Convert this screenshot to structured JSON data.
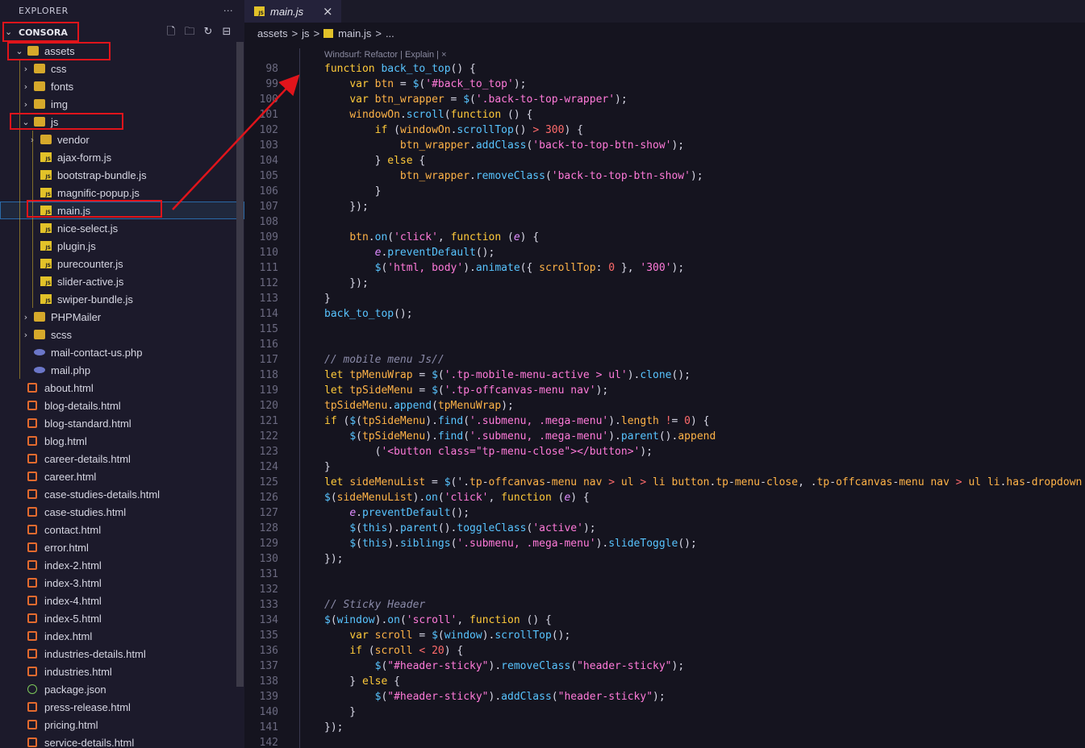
{
  "sidebar": {
    "title": "EXPLORER",
    "more_icon": "ellipsis-icon",
    "project": "CONSORA",
    "items": [
      {
        "label": "assets",
        "type": "folder",
        "state": "open"
      },
      {
        "label": "css",
        "type": "folder",
        "state": "closed"
      },
      {
        "label": "fonts",
        "type": "folder",
        "state": "closed"
      },
      {
        "label": "img",
        "type": "folder",
        "state": "closed"
      },
      {
        "label": "js",
        "type": "folder",
        "state": "open"
      },
      {
        "label": "vendor",
        "type": "folder",
        "state": "closed"
      },
      {
        "label": "ajax-form.js",
        "type": "js"
      },
      {
        "label": "bootstrap-bundle.js",
        "type": "js"
      },
      {
        "label": "magnific-popup.js",
        "type": "js"
      },
      {
        "label": "main.js",
        "type": "js",
        "selected": true
      },
      {
        "label": "nice-select.js",
        "type": "js"
      },
      {
        "label": "plugin.js",
        "type": "js"
      },
      {
        "label": "purecounter.js",
        "type": "js"
      },
      {
        "label": "slider-active.js",
        "type": "js"
      },
      {
        "label": "swiper-bundle.js",
        "type": "js"
      },
      {
        "label": "PHPMailer",
        "type": "folder",
        "state": "closed"
      },
      {
        "label": "scss",
        "type": "folder",
        "state": "closed"
      },
      {
        "label": "mail-contact-us.php",
        "type": "php"
      },
      {
        "label": "mail.php",
        "type": "php"
      },
      {
        "label": "about.html",
        "type": "html"
      },
      {
        "label": "blog-details.html",
        "type": "html"
      },
      {
        "label": "blog-standard.html",
        "type": "html"
      },
      {
        "label": "blog.html",
        "type": "html"
      },
      {
        "label": "career-details.html",
        "type": "html"
      },
      {
        "label": "career.html",
        "type": "html"
      },
      {
        "label": "case-studies-details.html",
        "type": "html"
      },
      {
        "label": "case-studies.html",
        "type": "html"
      },
      {
        "label": "contact.html",
        "type": "html"
      },
      {
        "label": "error.html",
        "type": "html"
      },
      {
        "label": "index-2.html",
        "type": "html"
      },
      {
        "label": "index-3.html",
        "type": "html"
      },
      {
        "label": "index-4.html",
        "type": "html"
      },
      {
        "label": "index-5.html",
        "type": "html"
      },
      {
        "label": "index.html",
        "type": "html"
      },
      {
        "label": "industries-details.html",
        "type": "html"
      },
      {
        "label": "industries.html",
        "type": "html"
      },
      {
        "label": "package.json",
        "type": "json"
      },
      {
        "label": "press-release.html",
        "type": "html"
      },
      {
        "label": "pricing.html",
        "type": "html"
      },
      {
        "label": "service-details.html",
        "type": "html"
      }
    ]
  },
  "tab": {
    "label": "main.js",
    "close": "×"
  },
  "breadcrumbs": [
    "assets",
    ">",
    "js",
    ">",
    "main.js",
    ">",
    "..."
  ],
  "codelens": "Windsurf: Refactor | Explain | ×",
  "code_lines": [
    {
      "n": "98",
      "t": "function back_to_top() {"
    },
    {
      "n": "99",
      "t": "    var btn = $('#back_to_top');"
    },
    {
      "n": "100",
      "t": "    var btn_wrapper = $('.back-to-top-wrapper');"
    },
    {
      "n": "101",
      "t": "    windowOn.scroll(function () {"
    },
    {
      "n": "102",
      "t": "        if (windowOn.scrollTop() > 300) {"
    },
    {
      "n": "103",
      "t": "            btn_wrapper.addClass('back-to-top-btn-show');"
    },
    {
      "n": "104",
      "t": "        } else {"
    },
    {
      "n": "105",
      "t": "            btn_wrapper.removeClass('back-to-top-btn-show');"
    },
    {
      "n": "106",
      "t": "        }"
    },
    {
      "n": "107",
      "t": "    });"
    },
    {
      "n": "108",
      "t": ""
    },
    {
      "n": "109",
      "t": "    btn.on('click', function (e) {"
    },
    {
      "n": "110",
      "t": "        e.preventDefault();"
    },
    {
      "n": "111",
      "t": "        $('html, body').animate({ scrollTop: 0 }, '300');"
    },
    {
      "n": "112",
      "t": "    });"
    },
    {
      "n": "113",
      "t": "}"
    },
    {
      "n": "114",
      "t": "back_to_top();"
    },
    {
      "n": "115",
      "t": ""
    },
    {
      "n": "116",
      "t": ""
    },
    {
      "n": "117",
      "t": "// mobile menu Js//"
    },
    {
      "n": "118",
      "t": "let tpMenuWrap = $('.tp-mobile-menu-active > ul').clone();"
    },
    {
      "n": "119",
      "t": "let tpSideMenu = $('.tp-offcanvas-menu nav');"
    },
    {
      "n": "120",
      "t": "tpSideMenu.append(tpMenuWrap);"
    },
    {
      "n": "121",
      "t": "if ($(tpSideMenu).find('.submenu, .mega-menu').length != 0) {"
    },
    {
      "n": "122",
      "t": "    $(tpSideMenu).find('.submenu, .mega-menu').parent().append"
    },
    {
      "n": "123",
      "t": "        ('<button class=\"tp-menu-close\"></button>');"
    },
    {
      "n": "124",
      "t": "}"
    },
    {
      "n": "125",
      "t": "let sideMenuList = $('.tp-offcanvas-menu nav > ul > li button.tp-menu-close, .tp-offcanvas-menu nav > ul li.has-dropdown >"
    },
    {
      "n": "126",
      "t": "$(sideMenuList).on('click', function (e) {"
    },
    {
      "n": "127",
      "t": "    e.preventDefault();"
    },
    {
      "n": "128",
      "t": "    $(this).parent().toggleClass('active');"
    },
    {
      "n": "129",
      "t": "    $(this).siblings('.submenu, .mega-menu').slideToggle();"
    },
    {
      "n": "130",
      "t": "});"
    },
    {
      "n": "131",
      "t": ""
    },
    {
      "n": "132",
      "t": ""
    },
    {
      "n": "133",
      "t": "// Sticky Header"
    },
    {
      "n": "134",
      "t": "$(window).on('scroll', function () {"
    },
    {
      "n": "135",
      "t": "    var scroll = $(window).scrollTop();"
    },
    {
      "n": "136",
      "t": "    if (scroll < 20) {"
    },
    {
      "n": "137",
      "t": "        $(\"#header-sticky\").removeClass(\"header-sticky\");"
    },
    {
      "n": "138",
      "t": "    } else {"
    },
    {
      "n": "139",
      "t": "        $(\"#header-sticky\").addClass(\"header-sticky\");"
    },
    {
      "n": "140",
      "t": "    }"
    },
    {
      "n": "141",
      "t": "});"
    },
    {
      "n": "142",
      "t": ""
    }
  ],
  "colors": {
    "annotation": "#e0141b",
    "accent": "#2a6aa8"
  }
}
